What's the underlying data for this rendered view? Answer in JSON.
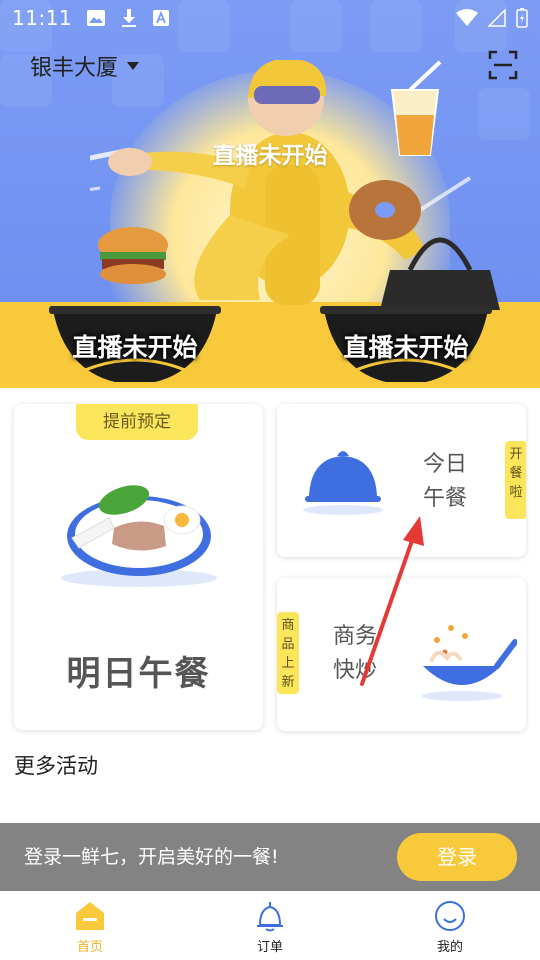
{
  "status_bar": {
    "time": "11:11"
  },
  "header": {
    "location": "银丰大厦"
  },
  "banner": {
    "live_status_main": "直播未开始",
    "live_status_left": "直播未开始",
    "live_status_right": "直播未开始"
  },
  "cards": {
    "tomorrow": {
      "tag": "提前预定",
      "label": "明日午餐"
    },
    "today": {
      "label_line1": "今日",
      "label_line2": "午餐",
      "side_tag": "开餐啦"
    },
    "business": {
      "label_line1": "商务",
      "label_line2": "快炒",
      "side_tag": "商品上新"
    }
  },
  "more_activities": {
    "title": "更多活动"
  },
  "login_bar": {
    "text": "登录一鲜七，开启美好的一餐!",
    "button_label": "登录"
  },
  "bottom_nav": {
    "items": [
      {
        "label": "首页",
        "icon": "home-icon",
        "active": true
      },
      {
        "label": "订单",
        "icon": "bell-icon",
        "active": false
      },
      {
        "label": "我的",
        "icon": "smile-icon",
        "active": false
      }
    ]
  },
  "colors": {
    "brand_yellow": "#f8c93a",
    "banner_blue": "#7c9cf4",
    "login_bar_gray": "#838383"
  }
}
